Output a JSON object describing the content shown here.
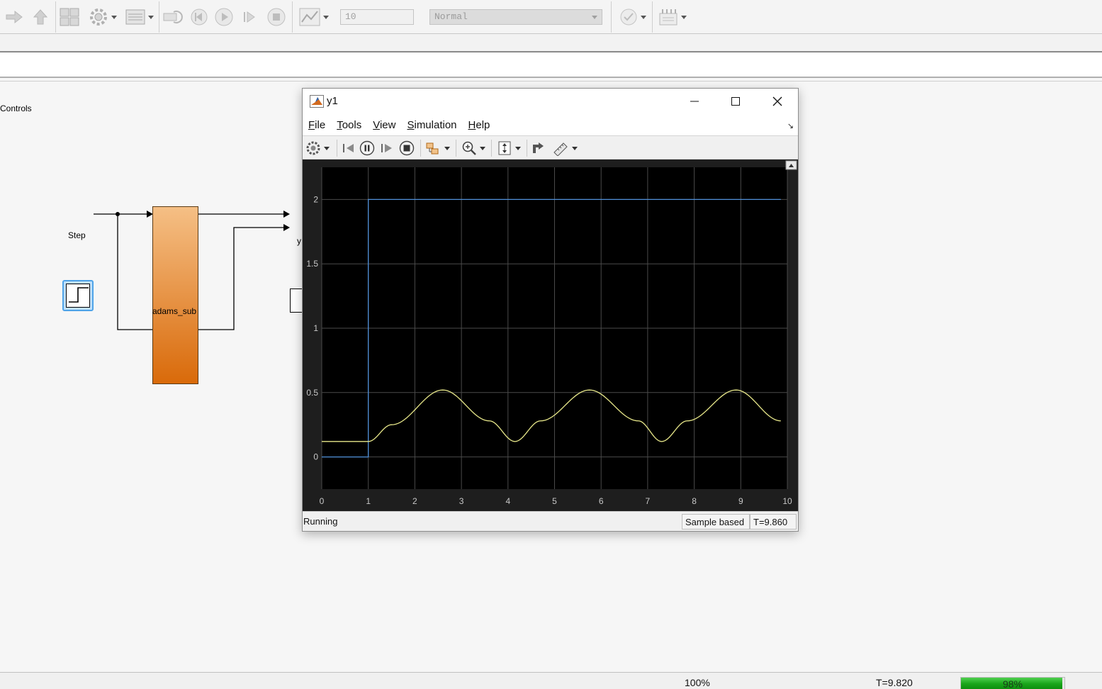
{
  "toolbar": {
    "stop_time": "10",
    "sim_mode": "Normal",
    "icons": [
      "forward-arrow-icon",
      "up-arrow-icon",
      "library-browser-icon",
      "model-settings-icon",
      "model-explorer-icon",
      "step-back-icon",
      "run-icon",
      "step-forward-icon",
      "stop-icon",
      "data-inspector-icon",
      "check-icon",
      "build-icon"
    ]
  },
  "canvas": {
    "controls_label": "Controls",
    "step_label": "Step",
    "subsystem_label": "adams_sub",
    "scope_stub_label": "y"
  },
  "scope": {
    "title": "y1",
    "menu": [
      {
        "key": "F",
        "rest": "ile"
      },
      {
        "key": "T",
        "rest": "ools"
      },
      {
        "key": "V",
        "rest": "iew"
      },
      {
        "key": "S",
        "rest": "imulation"
      },
      {
        "key": "H",
        "rest": "elp"
      }
    ],
    "status": "Running",
    "sample_mode": "Sample based",
    "time": "T=9.860"
  },
  "chart_data": {
    "type": "line",
    "xlim": [
      0,
      10
    ],
    "ylim": [
      -0.25,
      2.25
    ],
    "x_ticks": [
      "0",
      "1",
      "2",
      "3",
      "4",
      "5",
      "6",
      "7",
      "8",
      "9",
      "10"
    ],
    "y_ticks": [
      "0",
      "0.5",
      "1",
      "1.5",
      "2"
    ],
    "grid": true,
    "colors": {
      "background": "#000000",
      "grid": "#4a4a4a",
      "step_series": "#4f8fd8",
      "response_series": "#e8e88a"
    },
    "series": [
      {
        "x": [
          0,
          1,
          1,
          9.86
        ],
        "y": [
          0,
          0,
          2,
          2
        ]
      },
      {
        "x": [
          0,
          1,
          1.5,
          2.6,
          3.6,
          4.15,
          4.7,
          5.75,
          6.8,
          7.3,
          7.85,
          8.9,
          9.86
        ],
        "y": [
          0.12,
          0.12,
          0.25,
          0.52,
          0.28,
          0.12,
          0.28,
          0.52,
          0.28,
          0.12,
          0.28,
          0.52,
          0.28
        ]
      }
    ]
  },
  "statusbar": {
    "zoom": "100%",
    "time": "T=9.820",
    "progress_pct": 98,
    "progress_label": "98%"
  }
}
